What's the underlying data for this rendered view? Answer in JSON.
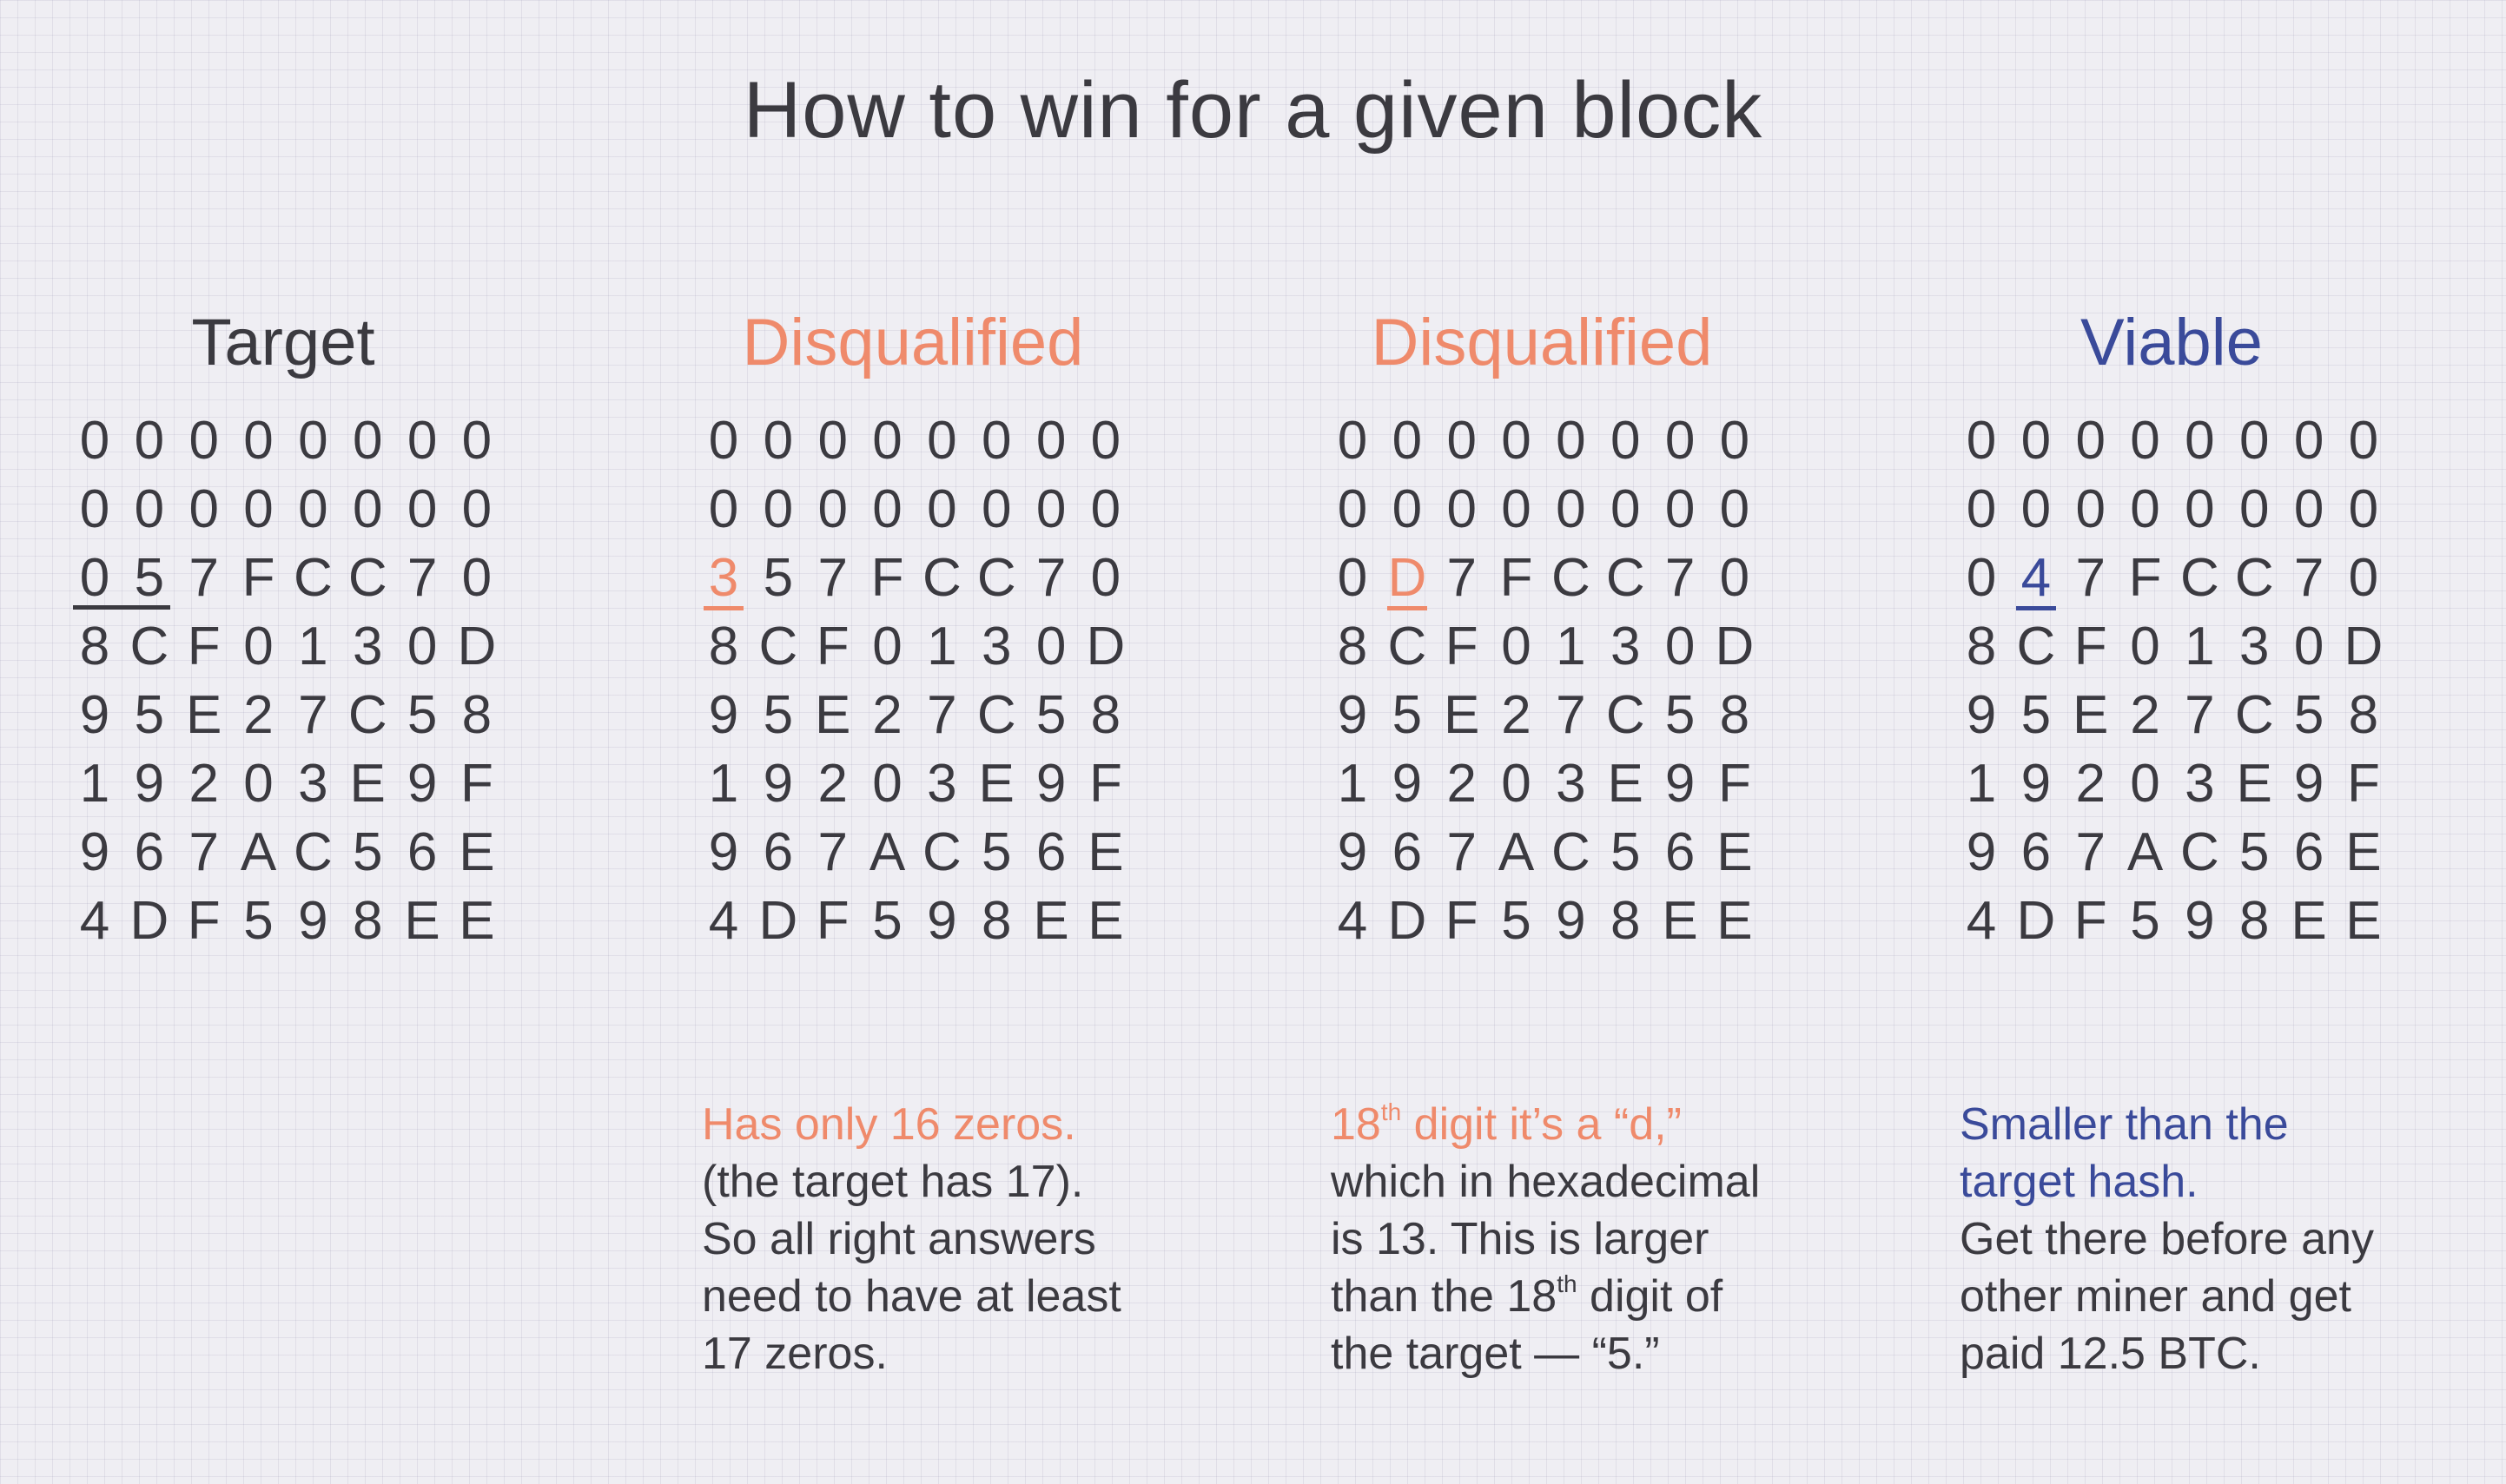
{
  "title": "How to win for a given block",
  "colors": {
    "text": "#3b3a40",
    "disqualified": "#ef8a6b",
    "viable": "#3a4a9a"
  },
  "columns": [
    {
      "heading": "Target",
      "rows": [
        [
          "0",
          "0",
          "0",
          "0",
          "0",
          "0",
          "0",
          "0"
        ],
        [
          "0",
          "0",
          "0",
          "0",
          "0",
          "0",
          "0",
          "0"
        ],
        [
          "0",
          "5",
          "7",
          "F",
          "C",
          "C",
          "7",
          "0"
        ],
        [
          "8",
          "C",
          "F",
          "0",
          "1",
          "3",
          "0",
          "D"
        ],
        [
          "9",
          "5",
          "E",
          "2",
          "7",
          "C",
          "5",
          "8"
        ],
        [
          "1",
          "9",
          "2",
          "0",
          "3",
          "E",
          "9",
          "F"
        ],
        [
          "9",
          "6",
          "7",
          "A",
          "C",
          "5",
          "6",
          "E"
        ],
        [
          "4",
          "D",
          "F",
          "5",
          "9",
          "8",
          "E",
          "E"
        ]
      ]
    },
    {
      "heading": "Disqualified",
      "rows": [
        [
          "0",
          "0",
          "0",
          "0",
          "0",
          "0",
          "0",
          "0"
        ],
        [
          "0",
          "0",
          "0",
          "0",
          "0",
          "0",
          "0",
          "0"
        ],
        [
          "3",
          "5",
          "7",
          "F",
          "C",
          "C",
          "7",
          "0"
        ],
        [
          "8",
          "C",
          "F",
          "0",
          "1",
          "3",
          "0",
          "D"
        ],
        [
          "9",
          "5",
          "E",
          "2",
          "7",
          "C",
          "5",
          "8"
        ],
        [
          "1",
          "9",
          "2",
          "0",
          "3",
          "E",
          "9",
          "F"
        ],
        [
          "9",
          "6",
          "7",
          "A",
          "C",
          "5",
          "6",
          "E"
        ],
        [
          "4",
          "D",
          "F",
          "5",
          "9",
          "8",
          "E",
          "E"
        ]
      ],
      "desc_lead": "Has only 16 zeros.",
      "desc_lines": [
        "(the target has 17).",
        "So all right answers",
        "need to have at least",
        "17 zeros."
      ]
    },
    {
      "heading": "Disqualified",
      "rows": [
        [
          "0",
          "0",
          "0",
          "0",
          "0",
          "0",
          "0",
          "0"
        ],
        [
          "0",
          "0",
          "0",
          "0",
          "0",
          "0",
          "0",
          "0"
        ],
        [
          "0",
          "D",
          "7",
          "F",
          "C",
          "C",
          "7",
          "0"
        ],
        [
          "8",
          "C",
          "F",
          "0",
          "1",
          "3",
          "0",
          "D"
        ],
        [
          "9",
          "5",
          "E",
          "2",
          "7",
          "C",
          "5",
          "8"
        ],
        [
          "1",
          "9",
          "2",
          "0",
          "3",
          "E",
          "9",
          "F"
        ],
        [
          "9",
          "6",
          "7",
          "A",
          "C",
          "5",
          "6",
          "E"
        ],
        [
          "4",
          "D",
          "F",
          "5",
          "9",
          "8",
          "E",
          "E"
        ]
      ],
      "desc_lead_num": "18",
      "desc_lead_sup": "th",
      "desc_lead_rest": " digit it’s a “d,”",
      "desc_line1": "which in hexadecimal",
      "desc_line2": "is 13. This is larger",
      "desc_line3_a": "than the 18",
      "desc_line3_sup": "th",
      "desc_line3_b": " digit of",
      "desc_line4": "the target — “5.”"
    },
    {
      "heading": "Viable",
      "rows": [
        [
          "0",
          "0",
          "0",
          "0",
          "0",
          "0",
          "0",
          "0"
        ],
        [
          "0",
          "0",
          "0",
          "0",
          "0",
          "0",
          "0",
          "0"
        ],
        [
          "0",
          "4",
          "7",
          "F",
          "C",
          "C",
          "7",
          "0"
        ],
        [
          "8",
          "C",
          "F",
          "0",
          "1",
          "3",
          "0",
          "D"
        ],
        [
          "9",
          "5",
          "E",
          "2",
          "7",
          "C",
          "5",
          "8"
        ],
        [
          "1",
          "9",
          "2",
          "0",
          "3",
          "E",
          "9",
          "F"
        ],
        [
          "9",
          "6",
          "7",
          "A",
          "C",
          "5",
          "6",
          "E"
        ],
        [
          "4",
          "D",
          "F",
          "5",
          "9",
          "8",
          "E",
          "E"
        ]
      ],
      "desc_lead": [
        "Smaller than the",
        "target hash."
      ],
      "desc_lines": [
        "Get there before any",
        "other miner and get",
        "paid 12.5 BTC."
      ]
    }
  ]
}
